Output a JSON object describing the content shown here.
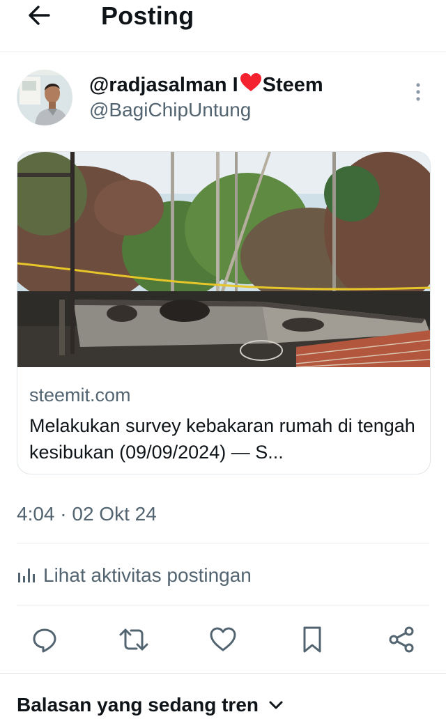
{
  "header": {
    "title": "Posting",
    "back_icon": "arrow-left-icon"
  },
  "post": {
    "display_name_before_heart": "@radjasalman I",
    "heart_emoji": "❤",
    "display_name_after_heart": "Steem",
    "handle": "@BagiChipUntung",
    "timestamp": "4:04 · 02 Okt 24"
  },
  "link_card": {
    "domain": "steemit.com",
    "title": "Melakukan survey kebakaran rumah di tengah kesibukan (09/09/2024) — S..."
  },
  "activity": {
    "label": "Lihat aktivitas postingan",
    "icon": "bar-chart-icon"
  },
  "actions": [
    "reply-icon",
    "repost-icon",
    "like-icon",
    "bookmark-icon",
    "share-icon"
  ],
  "trending": {
    "label": "Balasan yang sedang tren"
  },
  "colors": {
    "text": "#0f1419",
    "secondary": "#536471",
    "divider": "#e8ecef",
    "heart": "#f4212e"
  }
}
